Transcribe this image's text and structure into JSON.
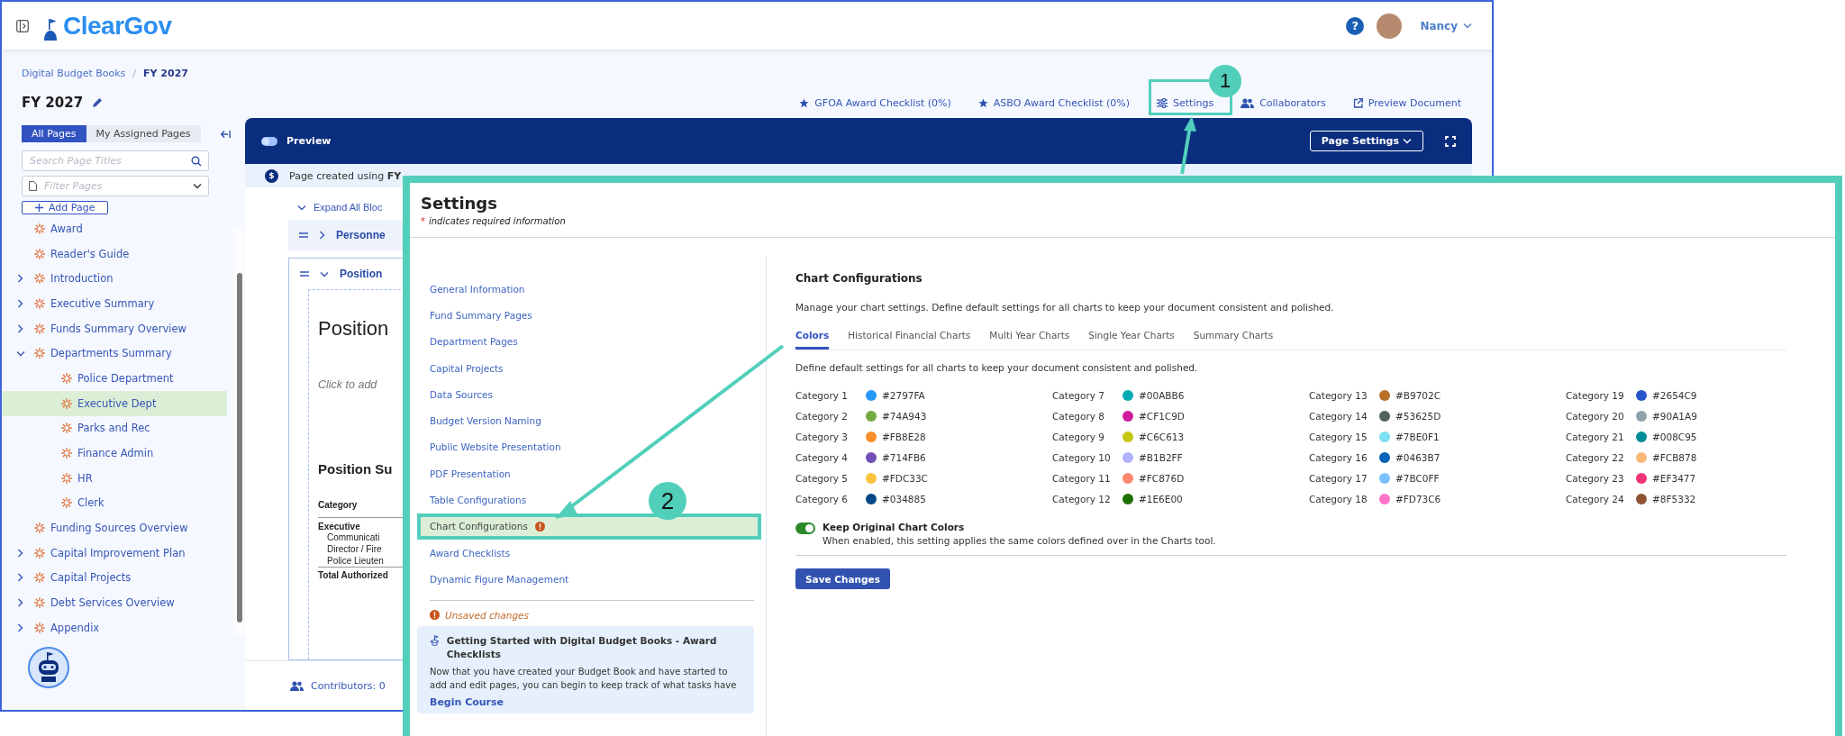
{
  "app_header": {
    "logo": "ClearGov",
    "help": "?",
    "user": {
      "name": "Nancy"
    }
  },
  "breadcrumb_separator": "/",
  "breadcrumb": [
    {
      "label": "Digital Budget Books",
      "current": false
    },
    {
      "label": "FY 2027",
      "current": true
    }
  ],
  "page_title": "FY 2027",
  "top_links": [
    {
      "label": "GFOA Award Checklist (0%)",
      "kind": "star"
    },
    {
      "label": "ASBO Award Checklist (0%)",
      "kind": "star"
    },
    {
      "label": "Settings",
      "kind": "sliders"
    },
    {
      "label": "Collaborators",
      "kind": "people"
    },
    {
      "label": "Preview Document",
      "kind": "external"
    }
  ],
  "sidebar": {
    "tabs": [
      {
        "label": "All Pages",
        "selected": true
      },
      {
        "label": "My Assigned Pages",
        "selected": false
      }
    ],
    "search": {
      "placeholder": "Search Page Titles"
    },
    "filter": {
      "placeholder": "Filter Pages"
    },
    "add_button": "Add Page",
    "tree": [
      {
        "label": "Award",
        "selected": false
      },
      {
        "label": "Reader's Guide",
        "selected": false
      },
      {
        "label": "Introduction",
        "selected": false,
        "expanded": false
      },
      {
        "label": "Executive Summary",
        "selected": false,
        "expanded": false
      },
      {
        "label": "Funds Summary Overview",
        "selected": false,
        "expanded": false
      },
      {
        "label": "Departments Summary",
        "selected": false,
        "expanded": true,
        "children": [
          {
            "label": "Police Department",
            "selected": false
          },
          {
            "label": "Executive Dept",
            "selected": true
          },
          {
            "label": "Parks and Rec",
            "selected": false
          },
          {
            "label": "Finance Admin",
            "selected": false
          },
          {
            "label": "HR",
            "selected": false
          },
          {
            "label": "Clerk",
            "selected": false
          }
        ]
      },
      {
        "label": "Funding Sources Overview",
        "selected": false
      },
      {
        "label": "Capital Improvement Plan",
        "selected": false,
        "expanded": false
      },
      {
        "label": "Capital Projects",
        "selected": false,
        "expanded": false
      },
      {
        "label": "Debt Services Overview",
        "selected": false,
        "expanded": false
      },
      {
        "label": "Appendix",
        "selected": false,
        "expanded": false
      }
    ]
  },
  "editor": {
    "preview_toggle": {
      "label": "Preview",
      "on": false
    },
    "page_settings_button": "Page Settings",
    "info_icon": "$",
    "info_bar": "Page created using **FY**",
    "expand_all": "Expand All Bloc",
    "blocks": [
      {
        "title": "Personne",
        "expanded": false
      },
      {
        "title": "Position",
        "expanded": true
      }
    ],
    "block_content": {
      "heading": "Position",
      "placeholder_text": "Click to add",
      "summary_title": "Position Su",
      "table": {
        "header": "Category",
        "group": "Executive",
        "rows": [
          "Communicati",
          "Director / Fire",
          "Police Lieuten"
        ],
        "total": "Total Authorized"
      }
    },
    "contributors": "Contributors: 0"
  },
  "settings_panel": {
    "title": "Settings",
    "required_mark": "*",
    "required_note": "indicates required information",
    "menu": [
      {
        "label": "General Information",
        "selected": false,
        "warning": false
      },
      {
        "label": "Fund Summary Pages",
        "selected": false,
        "warning": false
      },
      {
        "label": "Department Pages",
        "selected": false,
        "warning": false
      },
      {
        "label": "Capital Projects",
        "selected": false,
        "warning": false
      },
      {
        "label": "Data Sources",
        "selected": false,
        "warning": false
      },
      {
        "label": "Budget Version Naming",
        "selected": false,
        "warning": false
      },
      {
        "label": "Public Website Presentation",
        "selected": false,
        "warning": false
      },
      {
        "label": "PDF Presentation",
        "selected": false,
        "warning": false
      },
      {
        "label": "Table Configurations",
        "selected": false,
        "warning": false
      },
      {
        "label": "Chart Configurations",
        "selected": true,
        "warning": true
      },
      {
        "label": "Award Checklists",
        "selected": false,
        "warning": false
      },
      {
        "label": "Dynamic Figure Management",
        "selected": false,
        "warning": false
      }
    ],
    "unsaved_note": "Unsaved changes",
    "course_card": {
      "title": "Getting Started with Digital Budget Books - Award Checklists",
      "body": "Now that you have created your Budget Book and have started to add and edit pages, you can begin to keep track of what tasks have",
      "link": "Begin Course"
    },
    "section": {
      "title": "Chart Configurations",
      "description": "Manage your chart settings. Define default settings for all charts to keep your document consistent and polished.",
      "tabs": [
        {
          "label": "Colors",
          "selected": true
        },
        {
          "label": "Historical Financial Charts",
          "selected": false
        },
        {
          "label": "Multi Year Charts",
          "selected": false
        },
        {
          "label": "Single Year Charts",
          "selected": false
        },
        {
          "label": "Summary Charts",
          "selected": false
        }
      ],
      "tab_description": "Define default settings for all charts to keep your document consistent and polished.",
      "categories": [
        {
          "label": "Category 1",
          "color": "#2797fa",
          "value": "#2797FA"
        },
        {
          "label": "Category 2",
          "color": "#74a943",
          "value": "#74A943"
        },
        {
          "label": "Category 3",
          "color": "#fb8e28",
          "value": "#FB8E28"
        },
        {
          "label": "Category 4",
          "color": "#714fb6",
          "value": "#714FB6"
        },
        {
          "label": "Category 5",
          "color": "#fdc33c",
          "value": "#FDC33C"
        },
        {
          "label": "Category 6",
          "color": "#034885",
          "value": "#034885"
        },
        {
          "label": "Category 7",
          "color": "#00abb6",
          "value": "#00ABB6"
        },
        {
          "label": "Category 8",
          "color": "#cf1c9d",
          "value": "#CF1C9D"
        },
        {
          "label": "Category 9",
          "color": "#c6c613",
          "value": "#C6C613"
        },
        {
          "label": "Category 10",
          "color": "#b1b2ff",
          "value": "#B1B2FF"
        },
        {
          "label": "Category 11",
          "color": "#fc876d",
          "value": "#FC876D"
        },
        {
          "label": "Category 12",
          "color": "#1e6e00",
          "value": "#1E6E00"
        },
        {
          "label": "Category 13",
          "color": "#b9702c",
          "value": "#B9702C"
        },
        {
          "label": "Category 14",
          "color": "#53625d",
          "value": "#53625D"
        },
        {
          "label": "Category 15",
          "color": "#7be0f1",
          "value": "#7BE0F1"
        },
        {
          "label": "Category 16",
          "color": "#0463b7",
          "value": "#0463B7"
        },
        {
          "label": "Category 17",
          "color": "#7bc0ff",
          "value": "#7BC0FF"
        },
        {
          "label": "Category 18",
          "color": "#fd73c6",
          "value": "#FD73C6"
        },
        {
          "label": "Category 19",
          "color": "#2654c9",
          "value": "#2654C9"
        },
        {
          "label": "Category 20",
          "color": "#90a1a9",
          "value": "#90A1A9"
        },
        {
          "label": "Category 21",
          "color": "#008c95",
          "value": "#008C95"
        },
        {
          "label": "Category 22",
          "color": "#fcb878",
          "value": "#FCB878"
        },
        {
          "label": "Category 23",
          "color": "#ef3477",
          "value": "#EF3477"
        },
        {
          "label": "Category 24",
          "color": "#8f5332",
          "value": "#8F5332"
        }
      ],
      "keep_colors": {
        "label": "Keep Original Chart Colors",
        "description": "When enabled, this setting applies the same colors defined over in the Charts tool.",
        "on": true
      },
      "save_button": "Save Changes"
    }
  },
  "callouts": [
    {
      "number": "1"
    },
    {
      "number": "2"
    }
  ]
}
